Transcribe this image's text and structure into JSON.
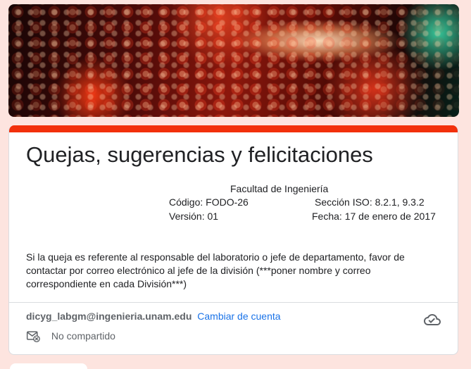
{
  "form": {
    "title": "Quejas, sugerencias y felicitaciones",
    "faculty": "Facultad de Ingeniería",
    "codigo": "Código: FODO-26",
    "seccion": "Sección ISO: 8.2.1, 9.3.2",
    "version": "Versión: 01",
    "fecha": "Fecha: 17 de enero de 2017",
    "description": "Si la queja es referente al responsable del laboratorio o jefe de departamento, favor de contactar por correo electrónico al jefe de la división (***poner nombre y correo correspondiente en cada División***)"
  },
  "account": {
    "email": "dicyg_labgm@ingenieria.unam.edu",
    "switch_label": "Cambiar de cuenta",
    "shared_status": "No compartido"
  },
  "icons": {
    "cloud": "cloud-check-icon",
    "mail": "mail-not-shared-icon"
  },
  "colors": {
    "page_background": "#fde4df",
    "accent": "#f2300b",
    "link": "#1a73e8"
  }
}
